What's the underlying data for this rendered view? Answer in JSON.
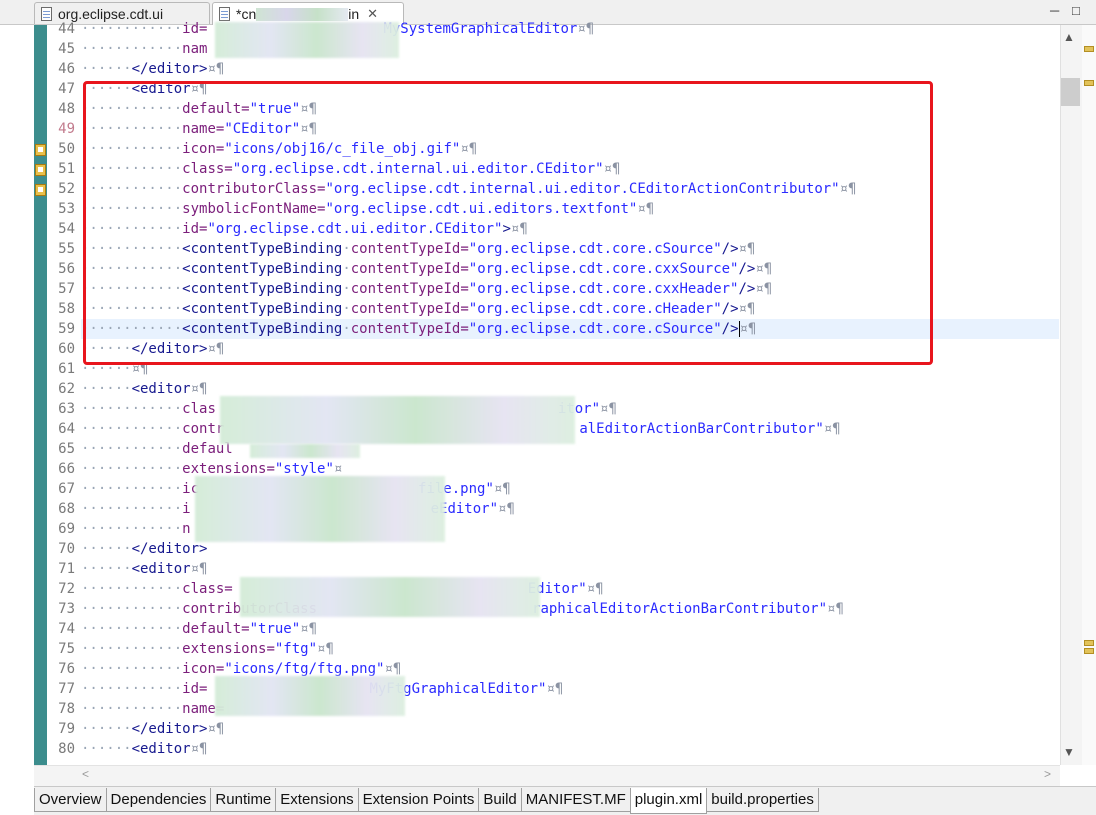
{
  "tabs": [
    {
      "label": "org.eclipse.cdt.ui",
      "active": false
    },
    {
      "label_prefix": "*cn",
      "label_suffix": "in",
      "active": true,
      "close": "✕"
    }
  ],
  "window_controls": {
    "minimize": "─",
    "maximize": "□"
  },
  "line_numbers": [
    "44",
    "45",
    "46",
    "47",
    "48",
    "49",
    "50",
    "51",
    "52",
    "53",
    "54",
    "55",
    "56",
    "57",
    "58",
    "59",
    "60",
    "61",
    "62",
    "63",
    "64",
    "65",
    "66",
    "67",
    "68",
    "69",
    "70",
    "71",
    "72",
    "73",
    "74",
    "75",
    "76",
    "77",
    "78",
    "79",
    "80"
  ],
  "code": {
    "l44": {
      "attr": "id=",
      "val": "MySystemGraphicalEditor",
      "end": "¤¶"
    },
    "l45": {
      "attr": "nam"
    },
    "l46": {
      "tag": "</editor>",
      "end": "¤¶"
    },
    "l47": {
      "tag": "<editor",
      "end": "¤¶"
    },
    "l48": {
      "attr": "default=",
      "val": "\"true\"",
      "end": "¤¶"
    },
    "l49": {
      "attr": "name=",
      "val": "\"CEditor\"",
      "end": "¤¶"
    },
    "l50": {
      "attr": "icon=",
      "val": "\"icons/obj16/c_file_obj.gif\"",
      "end": "¤¶"
    },
    "l51": {
      "attr": "class=",
      "val": "\"org.eclipse.cdt.internal.ui.editor.CEditor\"",
      "end": "¤¶"
    },
    "l52": {
      "attr": "contributorClass=",
      "val": "\"org.eclipse.cdt.internal.ui.editor.CEditorActionContributor\"",
      "end": "¤¶"
    },
    "l53": {
      "attr": "symbolicFontName=",
      "val": "\"org.eclipse.cdt.ui.editors.textfont\"",
      "end": "¤¶"
    },
    "l54": {
      "attr": "id=",
      "val": "\"org.eclipse.cdt.ui.editor.CEditor\"",
      "tag": ">",
      "end": "¤¶"
    },
    "l55": {
      "tag": "<contentTypeBinding",
      "attr": "contentTypeId=",
      "val": "\"org.eclipse.cdt.core.cSource\"",
      "close": "/>",
      "end": "¤¶"
    },
    "l56": {
      "tag": "<contentTypeBinding",
      "attr": "contentTypeId=",
      "val": "\"org.eclipse.cdt.core.cxxSource\"",
      "close": "/>",
      "end": "¤¶"
    },
    "l57": {
      "tag": "<contentTypeBinding",
      "attr": "contentTypeId=",
      "val": "\"org.eclipse.cdt.core.cxxHeader\"",
      "close": "/>",
      "end": "¤¶"
    },
    "l58": {
      "tag": "<contentTypeBinding",
      "attr": "contentTypeId=",
      "val": "\"org.eclipse.cdt.core.cHeader\"",
      "close": "/>",
      "end": "¤¶"
    },
    "l59": {
      "tag": "<contentTypeBinding",
      "attr": "contentTypeId=",
      "val": "\"org.eclipse.cdt.core.cSource\"",
      "close": "/>",
      "end": "¤¶"
    },
    "l60": {
      "tag": "</editor>",
      "end": "¤¶"
    },
    "l61": {
      "end": "¤¶"
    },
    "l62": {
      "tag": "<editor",
      "end": "¤¶"
    },
    "l63": {
      "attr": "clas",
      "val": "itor\"",
      "end": "¤¶"
    },
    "l64": {
      "attr": "contr",
      "val": "alEditorActionBarContributor\"",
      "end": "¤¶"
    },
    "l65": {
      "attr": "defaul"
    },
    "l66": {
      "attr": "extensions=",
      "val": "\"style\"",
      "end": "¤"
    },
    "l67": {
      "attr": "ic",
      "val": "file.png\"",
      "end": "¤¶"
    },
    "l68": {
      "attr": "i",
      "val": "eEditor\"",
      "end": "¤¶"
    },
    "l69": {
      "attr": "n"
    },
    "l70": {
      "tag": "</editor>"
    },
    "l71": {
      "tag": "<editor",
      "end": "¤¶"
    },
    "l72": {
      "attr": "class=",
      "val": "Editor\"",
      "end": "¤¶"
    },
    "l73": {
      "attr": "contributorClass",
      "val": "raphicalEditorActionBarContributor\"",
      "end": "¤¶"
    },
    "l74": {
      "attr": "default=",
      "val": "\"true\"",
      "end": "¤¶"
    },
    "l75": {
      "attr": "extensions=",
      "val": "\"ftg\"",
      "end": "¤¶"
    },
    "l76": {
      "attr": "icon=",
      "val": "\"icons/ftg/ftg.png\"",
      "end": "¤¶"
    },
    "l77": {
      "attr": "id=",
      "val": "MyFtgGraphicalEditor\"",
      "end": "¤¶"
    },
    "l78": {
      "attr": "name="
    },
    "l79": {
      "tag": "</editor>",
      "end": "¤¶"
    },
    "l80": {
      "tag": "<editor",
      "end": "¤¶"
    }
  },
  "bottom_tabs": [
    {
      "label": "Overview",
      "active": false
    },
    {
      "label": "Dependencies",
      "active": false
    },
    {
      "label": "Runtime",
      "active": false
    },
    {
      "label": "Extensions",
      "active": false
    },
    {
      "label": "Extension Points",
      "active": false
    },
    {
      "label": "Build",
      "active": false
    },
    {
      "label": "MANIFEST.MF",
      "active": false
    },
    {
      "label": "plugin.xml",
      "active": true
    },
    {
      "label": "build.properties",
      "active": false
    }
  ],
  "scroll": {
    "up": "▲",
    "down": "▼",
    "left": "<",
    "right": ">"
  },
  "colors": {
    "tag": "#17198f",
    "attribute": "#7b1e7b",
    "value": "#2b2bff",
    "highlight_box": "#e8151d",
    "left_strip": "#3c8d8d"
  }
}
